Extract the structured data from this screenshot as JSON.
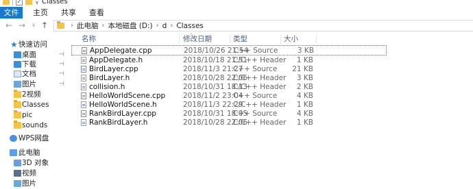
{
  "window": {
    "title": "Classes",
    "qa_dropdown": "∨"
  },
  "ribbon": {
    "tabs": [
      {
        "label": "文件"
      },
      {
        "label": "主页"
      },
      {
        "label": "共享"
      },
      {
        "label": "查看"
      }
    ]
  },
  "nav": {
    "back": "←",
    "forward": "→",
    "recent": "∨",
    "up": "↑"
  },
  "address": {
    "crumbs": [
      "此电脑",
      "本地磁盘 (D:)",
      "d",
      "Classes"
    ],
    "separator": "›"
  },
  "sidebar": {
    "items": [
      {
        "label": "快速访问",
        "icon": "star-icon",
        "pinned": false
      },
      {
        "label": "桌面",
        "icon": "desktop-icon",
        "pinned": true
      },
      {
        "label": "下载",
        "icon": "download-icon",
        "pinned": true
      },
      {
        "label": "文档",
        "icon": "document-icon",
        "pinned": true
      },
      {
        "label": "图片",
        "icon": "pictures-icon",
        "pinned": true
      },
      {
        "label": "2视频",
        "icon": "folder-icon",
        "pinned": false
      },
      {
        "label": "Classes",
        "icon": "folder-icon",
        "pinned": false
      },
      {
        "label": "pic",
        "icon": "folder-icon",
        "pinned": false
      },
      {
        "label": "sounds",
        "icon": "folder-icon",
        "pinned": false
      },
      {
        "label": "WPS网盘",
        "icon": "cloud-icon",
        "pinned": false
      },
      {
        "label": "此电脑",
        "icon": "computer-icon",
        "pinned": false
      },
      {
        "label": "3D 对象",
        "icon": "3d-objects-icon",
        "pinned": false
      },
      {
        "label": "视频",
        "icon": "video-icon",
        "pinned": false
      },
      {
        "label": "图片",
        "icon": "pictures-icon",
        "pinned": false
      }
    ],
    "pin_glyph": "⊣"
  },
  "columns": {
    "name": "名称",
    "date": "修改日期",
    "type": "类型",
    "size": "大小",
    "sort_glyph": "^"
  },
  "files": [
    {
      "name": "AppDelegate.cpp",
      "date": "2018/10/26 21:54",
      "type": "C++ Source",
      "size": "3 KB"
    },
    {
      "name": "AppDelegate.h",
      "date": "2018/10/18 21:51",
      "type": "C/C++ Header",
      "size": "1 KB"
    },
    {
      "name": "BirdLayer.cpp",
      "date": "2018/11/3 21:27",
      "type": "C++ Source",
      "size": "21 KB"
    },
    {
      "name": "BirdLayer.h",
      "date": "2018/10/28 22:06",
      "type": "C/C++ Header",
      "size": "3 KB"
    },
    {
      "name": "collision.h",
      "date": "2018/10/31 18:13",
      "type": "C/C++ Header",
      "size": "2 KB"
    },
    {
      "name": "HelloWorldScene.cpp",
      "date": "2018/11/2 23:04",
      "type": "C++ Source",
      "size": "4 KB"
    },
    {
      "name": "HelloWorldScene.h",
      "date": "2018/11/3 22:29",
      "type": "C/C++ Header",
      "size": "1 KB"
    },
    {
      "name": "RankBirdLayer.cpp",
      "date": "2018/10/31 18:05",
      "type": "C++ Source",
      "size": "4 KB"
    },
    {
      "name": "RankBirdLayer.h",
      "date": "2018/10/28 22:06",
      "type": "C/C++ Header",
      "size": "1 KB"
    }
  ],
  "colors": {
    "file_tab": "#1979ca",
    "folder": "#f2c44a",
    "header_text": "#4c607a"
  }
}
